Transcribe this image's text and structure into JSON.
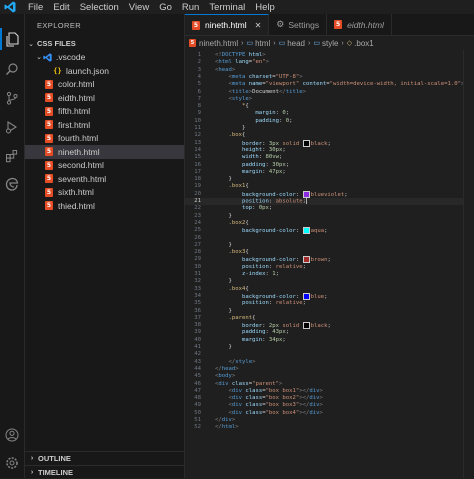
{
  "menubar": {
    "items": [
      "File",
      "Edit",
      "Selection",
      "View",
      "Go",
      "Run",
      "Terminal",
      "Help"
    ]
  },
  "activity_icons": [
    "explorer-icon",
    "search-icon",
    "source-control-icon",
    "run-debug-icon",
    "extensions-icon",
    "edge-devtools-icon",
    "account-icon",
    "manage-gear-icon"
  ],
  "sidebar": {
    "title": "EXPLORER",
    "folder": "CSS FILES",
    "subfolder": ".vscode",
    "subfolder_file": "launch.json",
    "files": [
      "color.html",
      "eidth.html",
      "fifth.html",
      "first.html",
      "fourth.html",
      "nineth.html",
      "second.html",
      "seventh.html",
      "sixth.html",
      "thied.html"
    ],
    "selected": "nineth.html",
    "outline": "OUTLINE",
    "timeline": "TIMELINE"
  },
  "tabs": [
    {
      "label": "nineth.html",
      "active": true
    },
    {
      "label": "Settings",
      "active": false
    },
    {
      "label": "eidth.html",
      "active": false
    }
  ],
  "breadcrumb": [
    "nineth.html",
    "html",
    "head",
    "style",
    ".box1"
  ],
  "editor": {
    "current_line": 21,
    "lines": [
      {
        "n": "1",
        "html": "<span class='t-punc'>&lt;!</span><span class='t-tag'>DOCTYPE</span> <span class='t-attr'>html</span><span class='t-punc'>&gt;</span>"
      },
      {
        "n": "2",
        "html": "<span class='t-punc'>&lt;</span><span class='t-tag'>html</span> <span class='t-attr'>lang</span>=<span class='t-str'>\"en\"</span><span class='t-punc'>&gt;</span>"
      },
      {
        "n": "3",
        "html": "<span class='t-punc'>&lt;</span><span class='t-tag'>head</span><span class='t-punc'>&gt;</span>"
      },
      {
        "n": "4",
        "html": "    <span class='t-punc'>&lt;</span><span class='t-tag'>meta</span> <span class='t-attr'>charset</span>=<span class='t-str'>\"UTF-8\"</span><span class='t-punc'>&gt;</span>"
      },
      {
        "n": "5",
        "html": "    <span class='t-punc'>&lt;</span><span class='t-tag'>meta</span> <span class='t-attr'>name</span>=<span class='t-str'>\"viewport\"</span> <span class='t-attr'>content</span>=<span class='t-str'>\"width=device-width, initial-scale=1.0\"</span><span class='t-punc'>&gt;</span>"
      },
      {
        "n": "6",
        "html": "    <span class='t-punc'>&lt;</span><span class='t-tag'>title</span><span class='t-punc'>&gt;</span>Document<span class='t-punc'>&lt;/</span><span class='t-tag'>title</span><span class='t-punc'>&gt;</span>"
      },
      {
        "n": "7",
        "html": "    <span class='t-punc'>&lt;</span><span class='t-tag'>style</span><span class='t-punc'>&gt;</span>"
      },
      {
        "n": "8",
        "html": "        <span class='t-sel'>*</span>{"
      },
      {
        "n": "9",
        "html": "            <span class='t-prop'>margin</span>: <span class='t-num'>0</span>;"
      },
      {
        "n": "10",
        "html": "            <span class='t-prop'>padding</span>: <span class='t-num'>0</span>;"
      },
      {
        "n": "11",
        "html": "        }"
      },
      {
        "n": "12",
        "html": "    <span class='t-sel'>.box</span>{"
      },
      {
        "n": "13",
        "html": "        <span class='t-prop'>border</span>: <span class='t-num'>3px</span> <span class='t-val'>solid</span> <span class='swatch' style='background:#000'></span><span class='t-val'>black</span>;"
      },
      {
        "n": "14",
        "html": "        <span class='t-prop'>height</span>: <span class='t-num'>30px</span>;"
      },
      {
        "n": "15",
        "html": "        <span class='t-prop'>width</span>: <span class='t-num'>80vw</span>;"
      },
      {
        "n": "16",
        "html": "        <span class='t-prop'>padding</span>: <span class='t-num'>30px</span>;"
      },
      {
        "n": "17",
        "html": "        <span class='t-prop'>margin</span>: <span class='t-num'>47px</span>;"
      },
      {
        "n": "18",
        "html": "    }"
      },
      {
        "n": "19",
        "html": "    <span class='t-sel'>.box1</span>{"
      },
      {
        "n": "20",
        "html": "        <span class='t-prop'>background-color</span>: <span class='swatch' style='background:#8a2be2'></span><span class='t-val'>blueviolet</span>;"
      },
      {
        "n": "21",
        "html": "        <span class='t-prop'>position</span>: <span class='t-val'>absolute</span>;<span class='cursor'></span>"
      },
      {
        "n": "22",
        "html": "        <span class='t-prop'>top</span>: <span class='t-num'>0px</span>;"
      },
      {
        "n": "23",
        "html": "    }"
      },
      {
        "n": "24",
        "html": "    <span class='t-sel'>.box2</span>{"
      },
      {
        "n": "25",
        "html": "        <span class='t-prop'>background-color</span>: <span class='swatch' style='background:#00ffff'></span><span class='t-val'>aqua</span>;"
      },
      {
        "n": "26",
        "html": ""
      },
      {
        "n": "27",
        "html": "    }"
      },
      {
        "n": "28",
        "html": "    <span class='t-sel'>.box3</span>{"
      },
      {
        "n": "29",
        "html": "        <span class='t-prop'>background-color</span>: <span class='swatch' style='background:#a52a2a'></span><span class='t-val'>brown</span>;"
      },
      {
        "n": "30",
        "html": "        <span class='t-prop'>position</span>: <span class='t-val'>relative</span>;"
      },
      {
        "n": "31",
        "html": "        <span class='t-prop'>z-index</span>: <span class='t-num'>1</span>;"
      },
      {
        "n": "32",
        "html": "    }"
      },
      {
        "n": "33",
        "html": "    <span class='t-sel'>.box4</span>{"
      },
      {
        "n": "34",
        "html": "        <span class='t-prop'>background-color</span>: <span class='swatch' style='background:#0000ff'></span><span class='t-val'>blue</span>;"
      },
      {
        "n": "35",
        "html": "        <span class='t-prop'>position</span>: <span class='t-val'>relative</span>;"
      },
      {
        "n": "36",
        "html": "    }"
      },
      {
        "n": "37",
        "html": "    <span class='t-sel'>.parent</span>{"
      },
      {
        "n": "38",
        "html": "        <span class='t-prop'>border</span>: <span class='t-num'>2px</span> <span class='t-val'>solid</span> <span class='swatch' style='background:#000'></span><span class='t-val'>black</span>;"
      },
      {
        "n": "39",
        "html": "        <span class='t-prop'>padding</span>: <span class='t-num'>43px</span>;"
      },
      {
        "n": "40",
        "html": "        <span class='t-prop'>margin</span>: <span class='t-num'>34px</span>;"
      },
      {
        "n": "41",
        "html": "    }"
      },
      {
        "n": "42",
        "html": ""
      },
      {
        "n": "43",
        "html": "    <span class='t-punc'>&lt;/</span><span class='t-tag'>style</span><span class='t-punc'>&gt;</span>"
      },
      {
        "n": "44",
        "html": "<span class='t-punc'>&lt;/</span><span class='t-tag'>head</span><span class='t-punc'>&gt;</span>"
      },
      {
        "n": "45",
        "html": "<span class='t-punc'>&lt;</span><span class='t-tag'>body</span><span class='t-punc'>&gt;</span>"
      },
      {
        "n": "46",
        "html": "<span class='t-punc'>&lt;</span><span class='t-tag'>div</span> <span class='t-attr'>class</span>=<span class='t-str'>\"parent\"</span><span class='t-punc'>&gt;</span>"
      },
      {
        "n": "47",
        "html": "    <span class='t-punc'>&lt;</span><span class='t-tag'>div</span> <span class='t-attr'>class</span>=<span class='t-str'>\"box box1\"</span><span class='t-punc'>&gt;&lt;/</span><span class='t-tag'>div</span><span class='t-punc'>&gt;</span>"
      },
      {
        "n": "48",
        "html": "    <span class='t-punc'>&lt;</span><span class='t-tag'>div</span> <span class='t-attr'>class</span>=<span class='t-str'>\"box box2\"</span><span class='t-punc'>&gt;&lt;/</span><span class='t-tag'>div</span><span class='t-punc'>&gt;</span>"
      },
      {
        "n": "49",
        "html": "    <span class='t-punc'>&lt;</span><span class='t-tag'>div</span> <span class='t-attr'>class</span>=<span class='t-str'>\"box box3\"</span><span class='t-punc'>&gt;&lt;/</span><span class='t-tag'>div</span><span class='t-punc'>&gt;</span>"
      },
      {
        "n": "50",
        "html": "    <span class='t-punc'>&lt;</span><span class='t-tag'>div</span> <span class='t-attr'>class</span>=<span class='t-str'>\"box box4\"</span><span class='t-punc'>&gt;&lt;/</span><span class='t-tag'>div</span><span class='t-punc'>&gt;</span>"
      },
      {
        "n": "51",
        "html": "<span class='t-punc'>&lt;/</span><span class='t-tag'>div</span><span class='t-punc'>&gt;</span>"
      },
      {
        "n": "52",
        "html": "<span class='t-punc'>&lt;/</span><span class='t-tag'>html</span><span class='t-punc'>&gt;</span>"
      }
    ]
  },
  "colors": {
    "accent": "#0078d4",
    "html_icon": "#e44d26",
    "vscode_folder": "#3794ff"
  }
}
